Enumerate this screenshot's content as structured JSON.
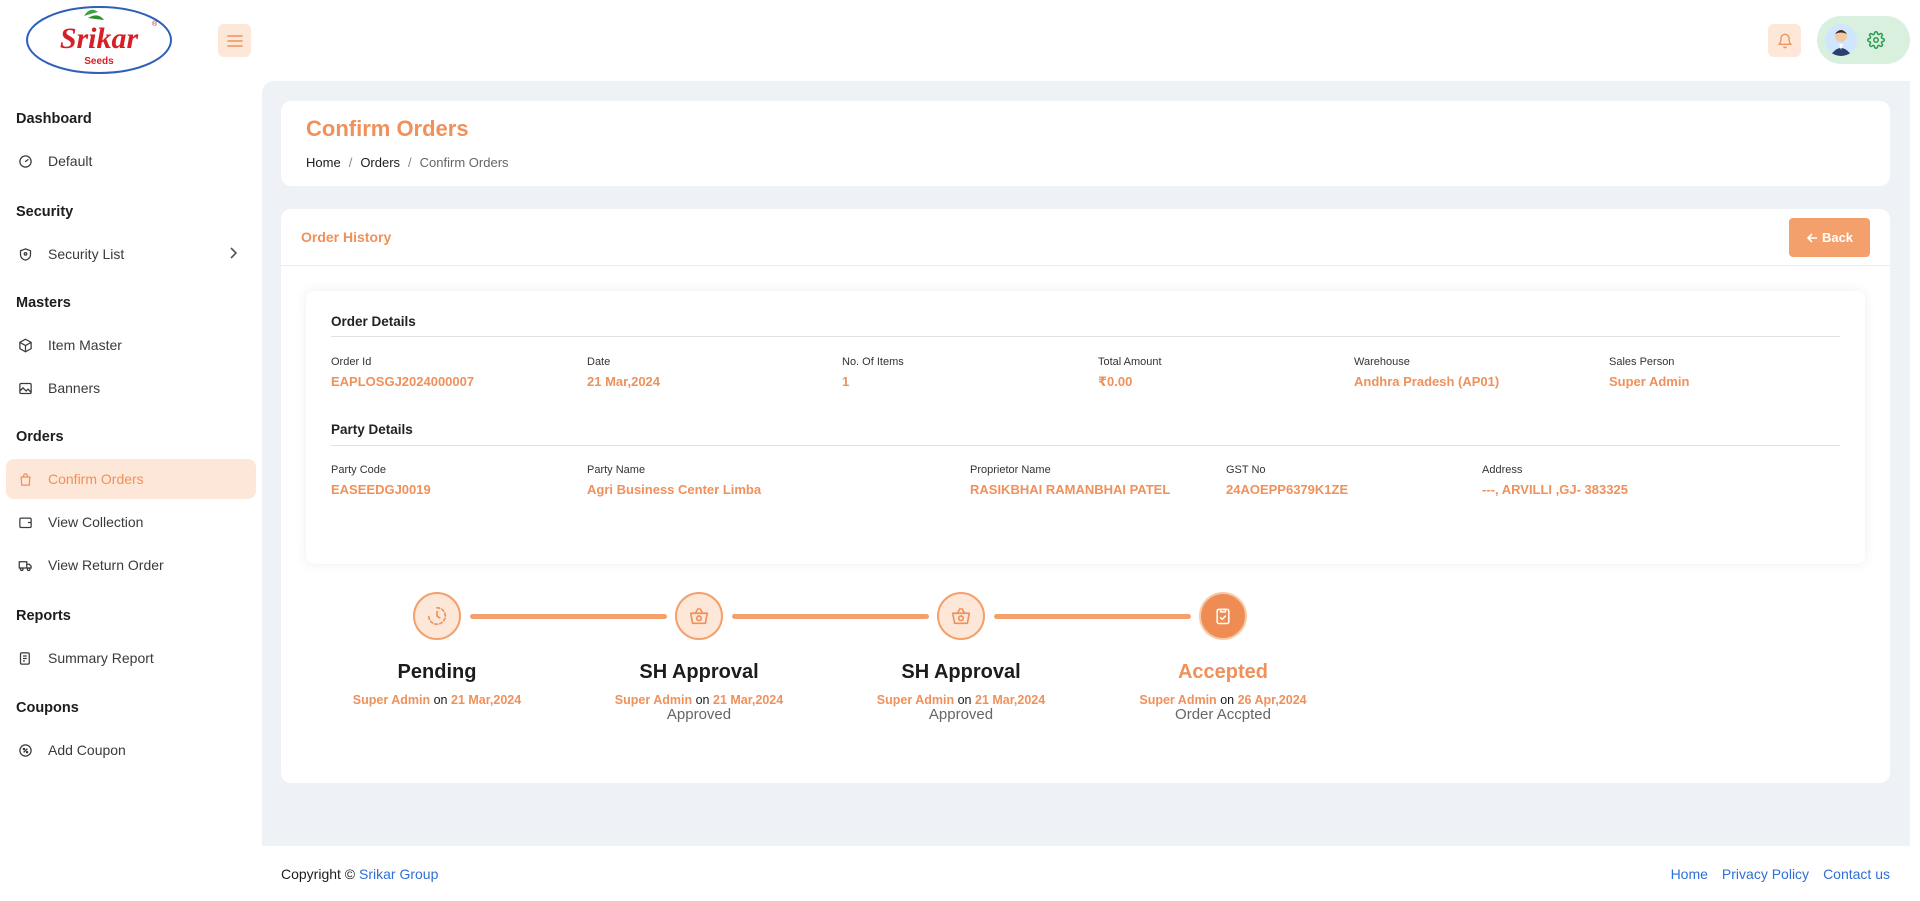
{
  "header": {
    "brand_name": "Srikar",
    "brand_sub": "Seeds"
  },
  "sidebar": {
    "sections": [
      {
        "heading": "Dashboard",
        "items": [
          {
            "label": "Default",
            "icon": "gauge-icon"
          }
        ]
      },
      {
        "heading": "Security",
        "items": [
          {
            "label": "Security List",
            "icon": "shield-icon"
          }
        ]
      },
      {
        "heading": "Masters",
        "items": [
          {
            "label": "Item Master",
            "icon": "box-icon"
          },
          {
            "label": "Banners",
            "icon": "image-icon"
          }
        ]
      },
      {
        "heading": "Orders",
        "items": [
          {
            "label": "Confirm Orders",
            "icon": "shopping-bag-icon",
            "active": true
          },
          {
            "label": "View Collection",
            "icon": "wallet-icon"
          },
          {
            "label": "View Return Order",
            "icon": "truck-icon"
          }
        ]
      },
      {
        "heading": "Reports",
        "items": [
          {
            "label": "Summary Report",
            "icon": "report-icon"
          }
        ]
      },
      {
        "heading": "Coupons",
        "items": [
          {
            "label": "Add Coupon",
            "icon": "coupon-icon"
          }
        ]
      }
    ]
  },
  "page": {
    "title": "Confirm Orders",
    "breadcrumb": [
      "Home",
      "Orders",
      "Confirm Orders"
    ],
    "breadcrumb_sep": "/"
  },
  "history": {
    "title": "Order History",
    "back_label": "Back"
  },
  "order_details": {
    "title": "Order Details",
    "fields": [
      {
        "label": "Order Id",
        "value": "EAPLOSGJ2024000007"
      },
      {
        "label": "Date",
        "value": "21 Mar,2024"
      },
      {
        "label": "No. Of Items",
        "value": "1"
      },
      {
        "label": "Total Amount",
        "value": "₹0.00"
      },
      {
        "label": "Warehouse",
        "value": "Andhra Pradesh (AP01)"
      },
      {
        "label": "Sales Person",
        "value": "Super Admin"
      }
    ]
  },
  "party_details": {
    "title": "Party Details",
    "fields": [
      {
        "label": "Party Code",
        "value": "EASEEDGJ0019"
      },
      {
        "label": "Party Name",
        "value": "Agri Business Center Limba"
      },
      {
        "label": "Proprietor Name",
        "value": "RASIKBHAI RAMANBHAI PATEL"
      },
      {
        "label": "GST No",
        "value": "24AOEPP6379K1ZE"
      },
      {
        "label": "Address",
        "value": "---, ARVILLI ,GJ- 383325"
      }
    ]
  },
  "timeline": {
    "on_word": "on",
    "steps": [
      {
        "title": "Pending",
        "by": "Super Admin",
        "date": "21 Mar,2024",
        "note": ""
      },
      {
        "title": "SH Approval",
        "by": "Super Admin",
        "date": "21 Mar,2024",
        "note": "Approved"
      },
      {
        "title": "SH Approval",
        "by": "Super Admin",
        "date": "21 Mar,2024",
        "note": "Approved"
      },
      {
        "title": "Accepted",
        "by": "Super Admin",
        "date": "26 Apr,2024",
        "note": "Order Accpted"
      }
    ]
  },
  "footer": {
    "copyright": "Copyright ©",
    "company": "Srikar Group",
    "links": [
      "Home",
      "Privacy Policy",
      "Contact us"
    ]
  },
  "colors": {
    "accent": "#f0905a",
    "accent_light": "#fde7d8",
    "link": "#2f6fd6",
    "brand_red": "#d62027"
  }
}
